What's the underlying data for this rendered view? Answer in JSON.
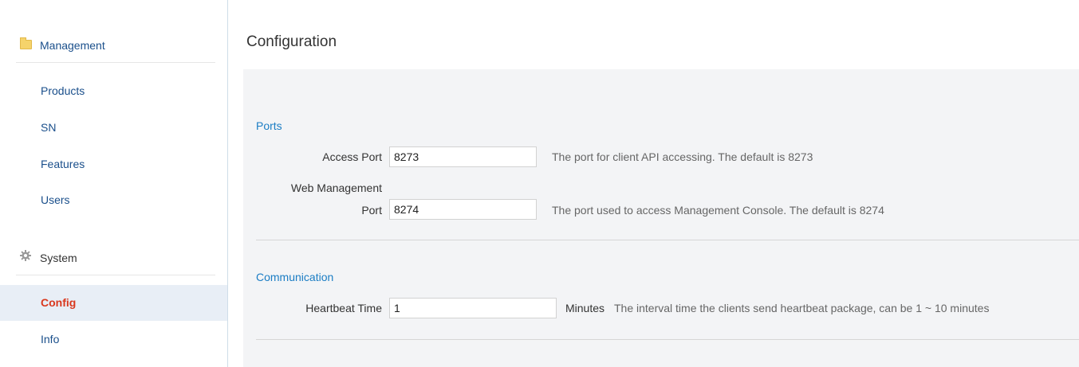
{
  "sidebar": {
    "sections": [
      {
        "title": "Management",
        "icon": "folder-icon",
        "items": [
          {
            "label": "Products",
            "active": false
          },
          {
            "label": "SN",
            "active": false
          },
          {
            "label": "Features",
            "active": false
          },
          {
            "label": "Users",
            "active": false
          }
        ]
      },
      {
        "title": "System",
        "icon": "gear-icon",
        "items": [
          {
            "label": "Config",
            "active": true
          },
          {
            "label": "Info",
            "active": false
          }
        ]
      }
    ]
  },
  "main": {
    "title": "Configuration",
    "groups": [
      {
        "title": "Ports",
        "fields": [
          {
            "label": "Access Port",
            "value": "8273",
            "hint": "The port for client API accessing. The default is 8273"
          },
          {
            "label_line1": "Web Management",
            "label_line2": "Port",
            "value": "8274",
            "hint": "The port used to access Management Console. The default is 8274"
          }
        ]
      },
      {
        "title": "Communication",
        "fields": [
          {
            "label": "Heartbeat Time",
            "value": "1",
            "unit": "Minutes",
            "hint": "The interval time the clients send heartbeat package, can be 1 ~ 10 minutes"
          }
        ]
      }
    ]
  },
  "colors": {
    "link": "#1a4f8b",
    "active_text": "#d9381e",
    "active_bg": "#e8eef6",
    "group_title": "#1b7dc4",
    "panel_bg": "#f3f4f6"
  }
}
